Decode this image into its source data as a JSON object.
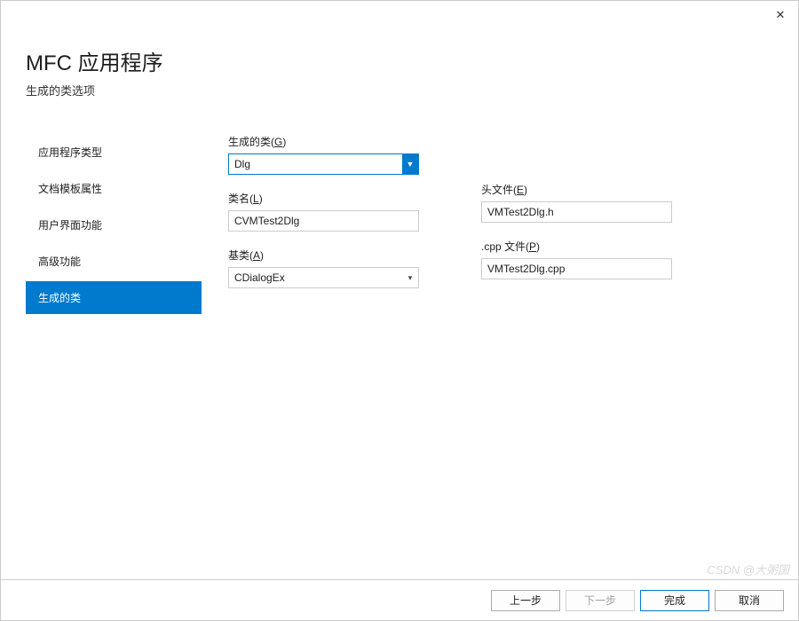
{
  "header": {
    "title": "MFC 应用程序",
    "subtitle": "生成的类选项"
  },
  "sidebar": {
    "items": [
      {
        "label": "应用程序类型"
      },
      {
        "label": "文档模板属性"
      },
      {
        "label": "用户界面功能"
      },
      {
        "label": "高级功能"
      },
      {
        "label": "生成的类"
      }
    ],
    "active": 4
  },
  "form": {
    "generated_class": {
      "label": "生成的类(",
      "mnemonic": "G",
      "label_close": ")",
      "value": "Dlg"
    },
    "class_name": {
      "label": "类名(",
      "mnemonic": "L",
      "label_close": ")",
      "value": "CVMTest2Dlg"
    },
    "base_class": {
      "label": "基类(",
      "mnemonic": "A",
      "label_close": ")",
      "value": "CDialogEx"
    },
    "header_file": {
      "label": "头文件(",
      "mnemonic": "E",
      "label_close": ")",
      "value": "VMTest2Dlg.h"
    },
    "cpp_file": {
      "label": ".cpp 文件(",
      "mnemonic": "P",
      "label_close": ")",
      "value": "VMTest2Dlg.cpp"
    }
  },
  "footer": {
    "prev": "上一步",
    "next": "下一步",
    "finish": "完成",
    "cancel": "取消"
  },
  "watermark": "CSDN @大粥国"
}
